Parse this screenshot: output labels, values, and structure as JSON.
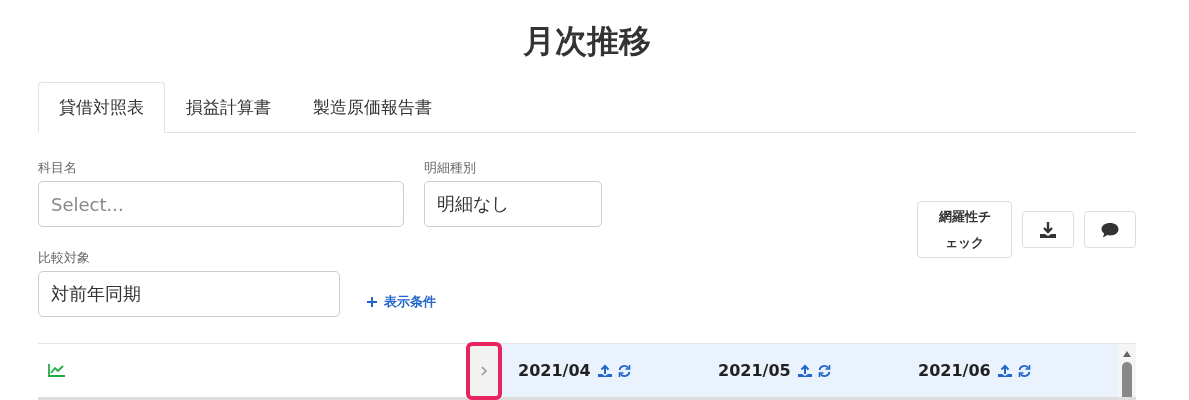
{
  "title": "月次推移",
  "tabs": [
    {
      "label": "貸借対照表",
      "selected": true
    },
    {
      "label": "損益計算書",
      "selected": false
    },
    {
      "label": "製造原価報告書",
      "selected": false
    }
  ],
  "filters": [
    {
      "label": "科目名",
      "placeholder": "Select..."
    },
    {
      "label": "明細種別",
      "value": "明細なし"
    },
    {
      "label": "比較対象",
      "value": "対前年同期"
    }
  ],
  "add_condition": {
    "label": "表示条件"
  },
  "actions": [
    {
      "kind": "text",
      "label": "網羅性チェック"
    },
    {
      "kind": "download"
    },
    {
      "kind": "comment"
    }
  ],
  "table_header": {
    "expand_toggle": {
      "highlighted": true
    },
    "months": [
      {
        "label": "2021/04"
      },
      {
        "label": "2021/05"
      },
      {
        "label": "2021/06"
      }
    ]
  }
}
